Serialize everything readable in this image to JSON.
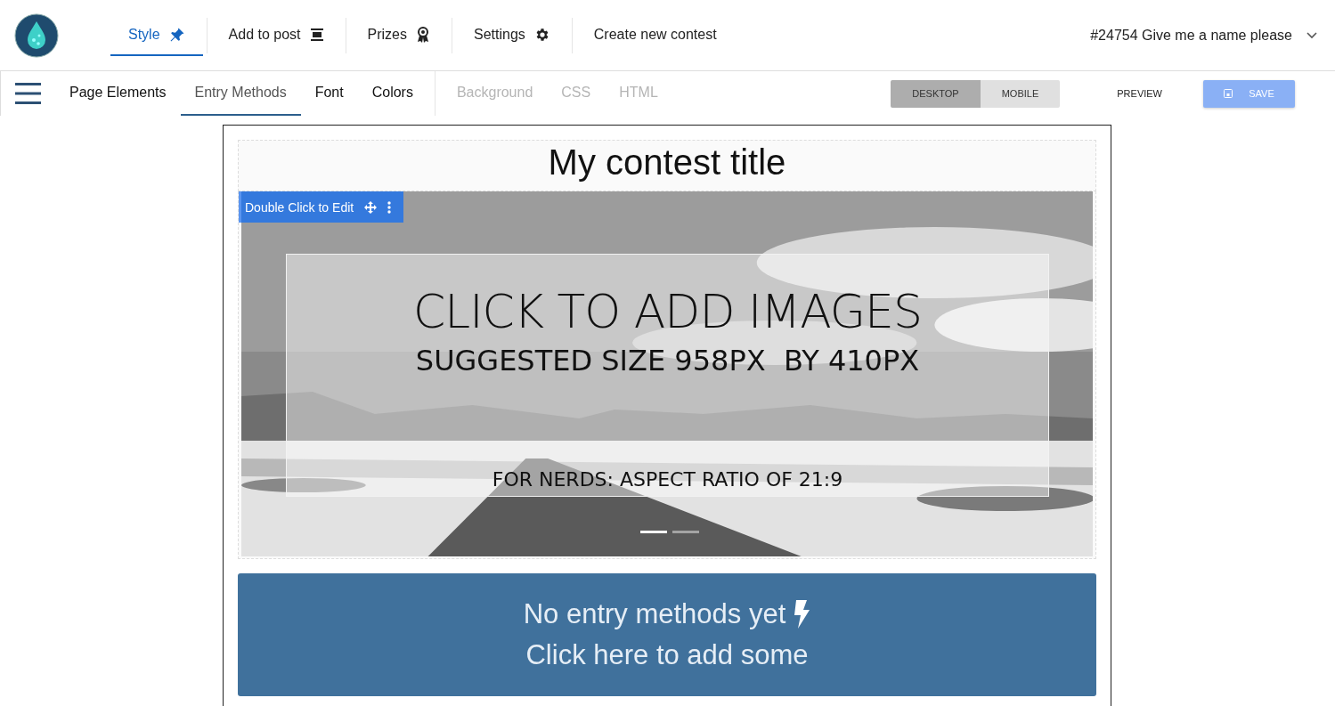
{
  "top_nav": {
    "items": [
      {
        "label": "Style",
        "kind": "pin",
        "selected": true
      },
      {
        "label": "Add to post",
        "kind": "embed",
        "selected": false
      },
      {
        "label": "Prizes",
        "kind": "award",
        "selected": false
      },
      {
        "label": "Settings",
        "kind": "gear",
        "selected": false
      },
      {
        "label": "Create new contest",
        "kind": "plain",
        "selected": false
      }
    ],
    "contest": "#24754 Give me a name please"
  },
  "toolbar": {
    "tabs": [
      {
        "label": "Page Elements",
        "selected": false,
        "disabled": false
      },
      {
        "label": "Entry Methods",
        "selected": true,
        "disabled": false
      },
      {
        "label": "Font",
        "selected": false,
        "disabled": false
      },
      {
        "label": "Colors",
        "selected": false,
        "disabled": false
      },
      {
        "label": "Background",
        "selected": false,
        "disabled": true
      },
      {
        "label": "CSS",
        "selected": false,
        "disabled": true
      },
      {
        "label": "HTML",
        "selected": false,
        "disabled": true
      }
    ],
    "views": [
      {
        "label": "DESKTOP",
        "selected": true
      },
      {
        "label": "MOBILE",
        "selected": false
      }
    ],
    "preview": "PREVIEW",
    "save": "SAVE"
  },
  "canvas": {
    "title": "My contest title",
    "image_block": {
      "edit_label": "Double Click to Edit",
      "heading": "CLICK TO ADD IMAGES",
      "size": "SUGGESTED SIZE 958PX  BY 410PX",
      "ratio": "FOR NERDS: ASPECT RATIO OF 21:9",
      "indicators": [
        {
          "selected": true
        },
        {
          "selected": false
        }
      ]
    },
    "entry_box": {
      "line_1": "No entry methods yet",
      "line_2": "Click here to add some"
    }
  }
}
